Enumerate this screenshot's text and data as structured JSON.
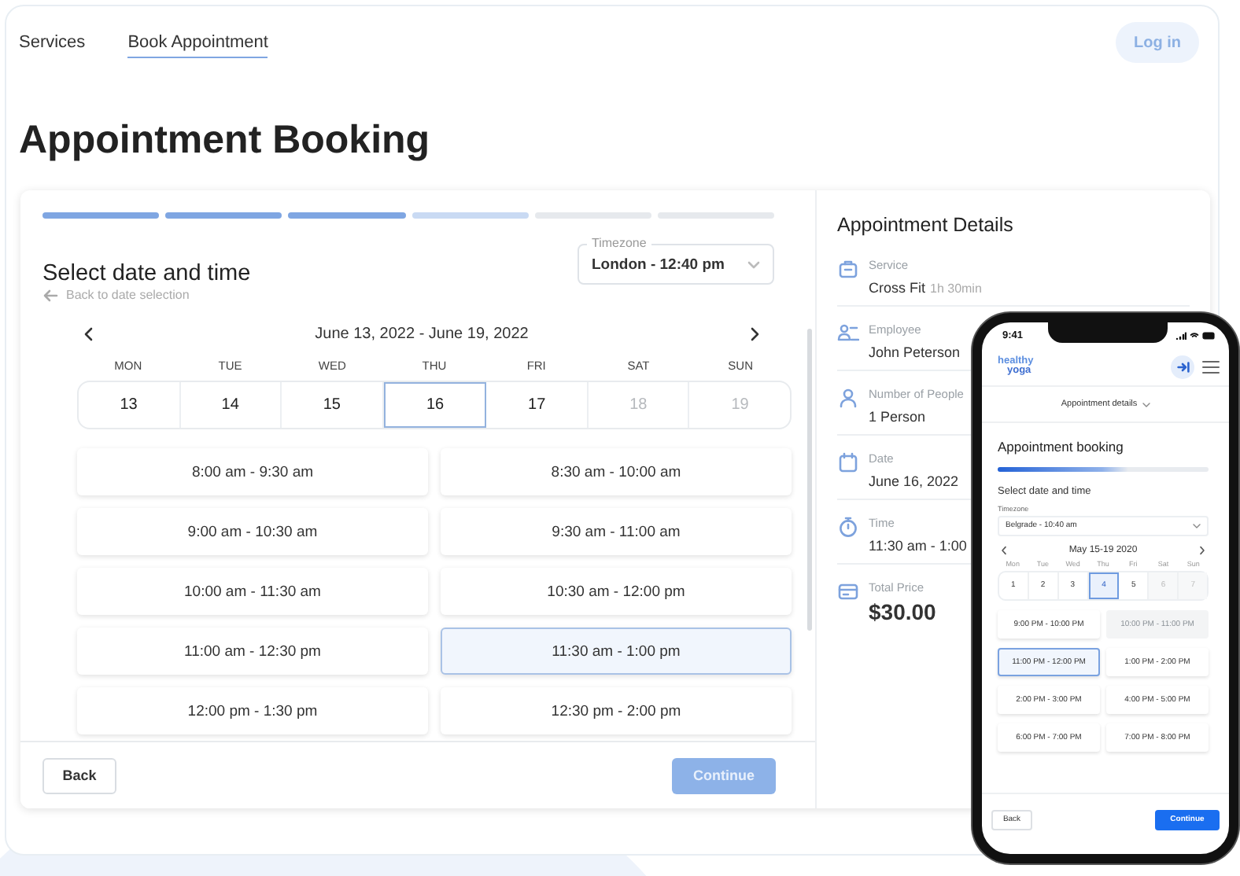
{
  "nav": {
    "links": [
      {
        "label": "Services",
        "selected": false
      },
      {
        "label": "Book Appointment",
        "selected": true
      }
    ],
    "login": "Log in"
  },
  "title": "Appointment Booking",
  "booking": {
    "steps": [
      {
        "kind": "done"
      },
      {
        "kind": "done"
      },
      {
        "kind": "done"
      },
      {
        "kind": "current"
      },
      {
        "kind": "todo"
      },
      {
        "kind": "todo"
      }
    ],
    "heading": "Select date and time",
    "back_link": "Back to date selection",
    "timezone": {
      "label": "Timezone",
      "value": "London - 12:40 pm"
    },
    "week": "June 13, 2022 - June 19, 2022",
    "days": [
      {
        "name": "MON",
        "date": "13",
        "selected": false,
        "disabled": false
      },
      {
        "name": "TUE",
        "date": "14",
        "selected": false,
        "disabled": false
      },
      {
        "name": "WED",
        "date": "15",
        "selected": false,
        "disabled": false
      },
      {
        "name": "THU",
        "date": "16",
        "selected": true,
        "disabled": false
      },
      {
        "name": "FRI",
        "date": "17",
        "selected": false,
        "disabled": false
      },
      {
        "name": "SAT",
        "date": "18",
        "selected": false,
        "disabled": true
      },
      {
        "name": "SUN",
        "date": "19",
        "selected": false,
        "disabled": true
      }
    ],
    "slots": [
      {
        "label": "8:00 am - 9:30 am",
        "selected": false
      },
      {
        "label": "8:30 am - 10:00 am",
        "selected": false
      },
      {
        "label": "9:00 am - 10:30 am",
        "selected": false
      },
      {
        "label": "9:30 am - 11:00 am",
        "selected": false
      },
      {
        "label": "10:00 am - 11:30 am",
        "selected": false
      },
      {
        "label": "10:30 am - 12:00 pm",
        "selected": false
      },
      {
        "label": "11:00 am - 12:30 pm",
        "selected": false
      },
      {
        "label": "11:30 am - 1:00 pm",
        "selected": true
      },
      {
        "label": "12:00 pm - 1:30 pm",
        "selected": false
      },
      {
        "label": "12:30 pm - 2:00 pm",
        "selected": false
      }
    ],
    "back_button": "Back",
    "continue_button": "Continue"
  },
  "details": {
    "title": "Appointment Details",
    "items": [
      {
        "kind": "service",
        "label": "Service",
        "value": "Cross Fit",
        "note": "1h 30min"
      },
      {
        "kind": "employee",
        "label": "Employee",
        "value": "John Peterson"
      },
      {
        "kind": "people",
        "label": "Number of People",
        "value": "1 Person"
      },
      {
        "kind": "date",
        "label": "Date",
        "value": "June 16, 2022"
      },
      {
        "kind": "time",
        "label": "Time",
        "value": "11:30 am - 1:00"
      },
      {
        "kind": "price",
        "label": "Total Price",
        "value": "$30.00"
      }
    ]
  },
  "phone": {
    "time": "9:41",
    "logo": [
      "healthy",
      "yoga"
    ],
    "details_toggle": "Appointment details",
    "title": "Appointment booking",
    "progress": {
      "level": 0.62
    },
    "heading": "Select date and time",
    "timezone": {
      "label": "Timezone",
      "value": "Belgrade - 10:40 am"
    },
    "week": "May 15-19 2020",
    "days": [
      {
        "name": "Mon",
        "date": "1",
        "selected": false,
        "disabled": false
      },
      {
        "name": "Tue",
        "date": "2",
        "selected": false,
        "disabled": false
      },
      {
        "name": "Wed",
        "date": "3",
        "selected": false,
        "disabled": false
      },
      {
        "name": "Thu",
        "date": "4",
        "selected": true,
        "disabled": false
      },
      {
        "name": "Fri",
        "date": "5",
        "selected": false,
        "disabled": false
      },
      {
        "name": "Sat",
        "date": "6",
        "selected": false,
        "disabled": true
      },
      {
        "name": "Sun",
        "date": "7",
        "selected": false,
        "disabled": true
      }
    ],
    "slots": [
      {
        "label": "9:00 PM - 10:00 PM",
        "selected": false,
        "disabled": false
      },
      {
        "label": "10:00 PM - 11:00 PM",
        "selected": false,
        "disabled": true
      },
      {
        "label": "11:00 PM - 12:00 PM",
        "selected": true,
        "disabled": false
      },
      {
        "label": "1:00 PM - 2:00 PM",
        "selected": false,
        "disabled": false
      },
      {
        "label": "2:00 PM - 3:00 PM",
        "selected": false,
        "disabled": false
      },
      {
        "label": "4:00 PM - 5:00 PM",
        "selected": false,
        "disabled": false
      },
      {
        "label": "6:00 PM - 7:00 PM",
        "selected": false,
        "disabled": false
      },
      {
        "label": "7:00 PM - 8:00 PM",
        "selected": false,
        "disabled": false
      }
    ],
    "back_button": "Back",
    "continue_button": "Continue"
  }
}
